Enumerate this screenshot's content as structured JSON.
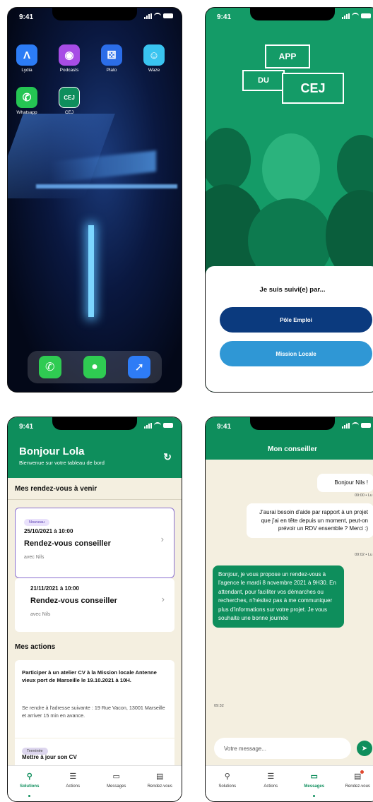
{
  "status_time": "9:41",
  "home": {
    "apps": [
      {
        "label": "Lydia",
        "icon": "lydia-icon",
        "glyph": "Λ",
        "color": "#2c7cf6"
      },
      {
        "label": "Podcasts",
        "icon": "podcasts-icon",
        "glyph": "◉",
        "color": "#a74ce5"
      },
      {
        "label": "Plato",
        "icon": "plato-icon",
        "glyph": "⚄",
        "color": "#2b6de8"
      },
      {
        "label": "Waze",
        "icon": "waze-icon",
        "glyph": "☺",
        "color": "#39c4f0"
      },
      {
        "label": "Whatsapp",
        "icon": "whatsapp-icon",
        "glyph": "✆",
        "color": "#25c553"
      },
      {
        "label": "CEJ",
        "icon": "cej-app-icon",
        "glyph": "CEJ",
        "color": "#0e8e5c"
      }
    ],
    "dock": [
      {
        "icon": "phone-icon",
        "glyph": "✆",
        "color": "#2fcb52"
      },
      {
        "icon": "messages-icon",
        "glyph": "●",
        "color": "#2fcb52"
      },
      {
        "icon": "safari-icon",
        "glyph": "➚",
        "color": "#2e7cf6"
      }
    ]
  },
  "splash": {
    "logo_app": "APP",
    "logo_du": "DU",
    "logo_cej": "CEJ",
    "question": "Je suis suivi(e) par...",
    "btn_pole": "Pôle Emploi",
    "btn_mission": "Mission Locale",
    "color_pole": "#0b3a7e",
    "color_mission": "#2f97d5"
  },
  "dashboard": {
    "title": "Bonjour Lola",
    "subtitle": "Bienvenue sur votre tableau de bord",
    "rdv_section": "Mes rendez-vous à venir",
    "rdv": [
      {
        "tag": "Nouveau",
        "date": "25/10/2021 à 10:00",
        "title": "Rendez-vous conseiller",
        "with": "avec Nils"
      },
      {
        "date": "21/11/2021 à 10:00",
        "title": "Rendez-vous conseiller",
        "with": "avec Nils"
      }
    ],
    "actions_section": "Mes actions",
    "action1_title": "Participer à un atelier CV à la Mission locale Antenne vieux port de Marseille le 19.10.2021 à 10H.",
    "action1_desc": "Se rendre à l'adresse suivante : 19 Rue Vacon, 13001 Marseille et arriver 15 min en avance.",
    "action2_tag": "Terminée",
    "action2_title": "Mettre à jour son CV"
  },
  "tabs": [
    {
      "label": "Solutions",
      "icon": "search-icon",
      "glyph": "⚲"
    },
    {
      "label": "Actions",
      "icon": "checklist-icon",
      "glyph": "☰"
    },
    {
      "label": "Messages",
      "icon": "message-icon",
      "glyph": "▭"
    },
    {
      "label": "Rendez-vous",
      "icon": "calendar-icon",
      "glyph": "▤"
    }
  ],
  "chat": {
    "title": "Mon conseiller",
    "msg1": "Bonjour Nils !",
    "msg1_time": "09:00 • Lu",
    "msg2": "J'aurai besoin d'aide par rapport à un projet que j'ai en tête depuis un moment, peut-on prévoir un RDV ensemble ? Merci :)",
    "msg2_time": "09:02 • Lu",
    "msg3": "Bonjour, je vous propose un rendez-vous à l'agence le mardi 8 novembre 2021 à 9H30. En attendant, pour faciliter vos démarches ou recherches, n'hésitez pas à me communiquer plus d'informations sur votre projet. Je vous souhaite une bonne journée",
    "msg3_time": "09:32",
    "placeholder": "Votre message..."
  }
}
